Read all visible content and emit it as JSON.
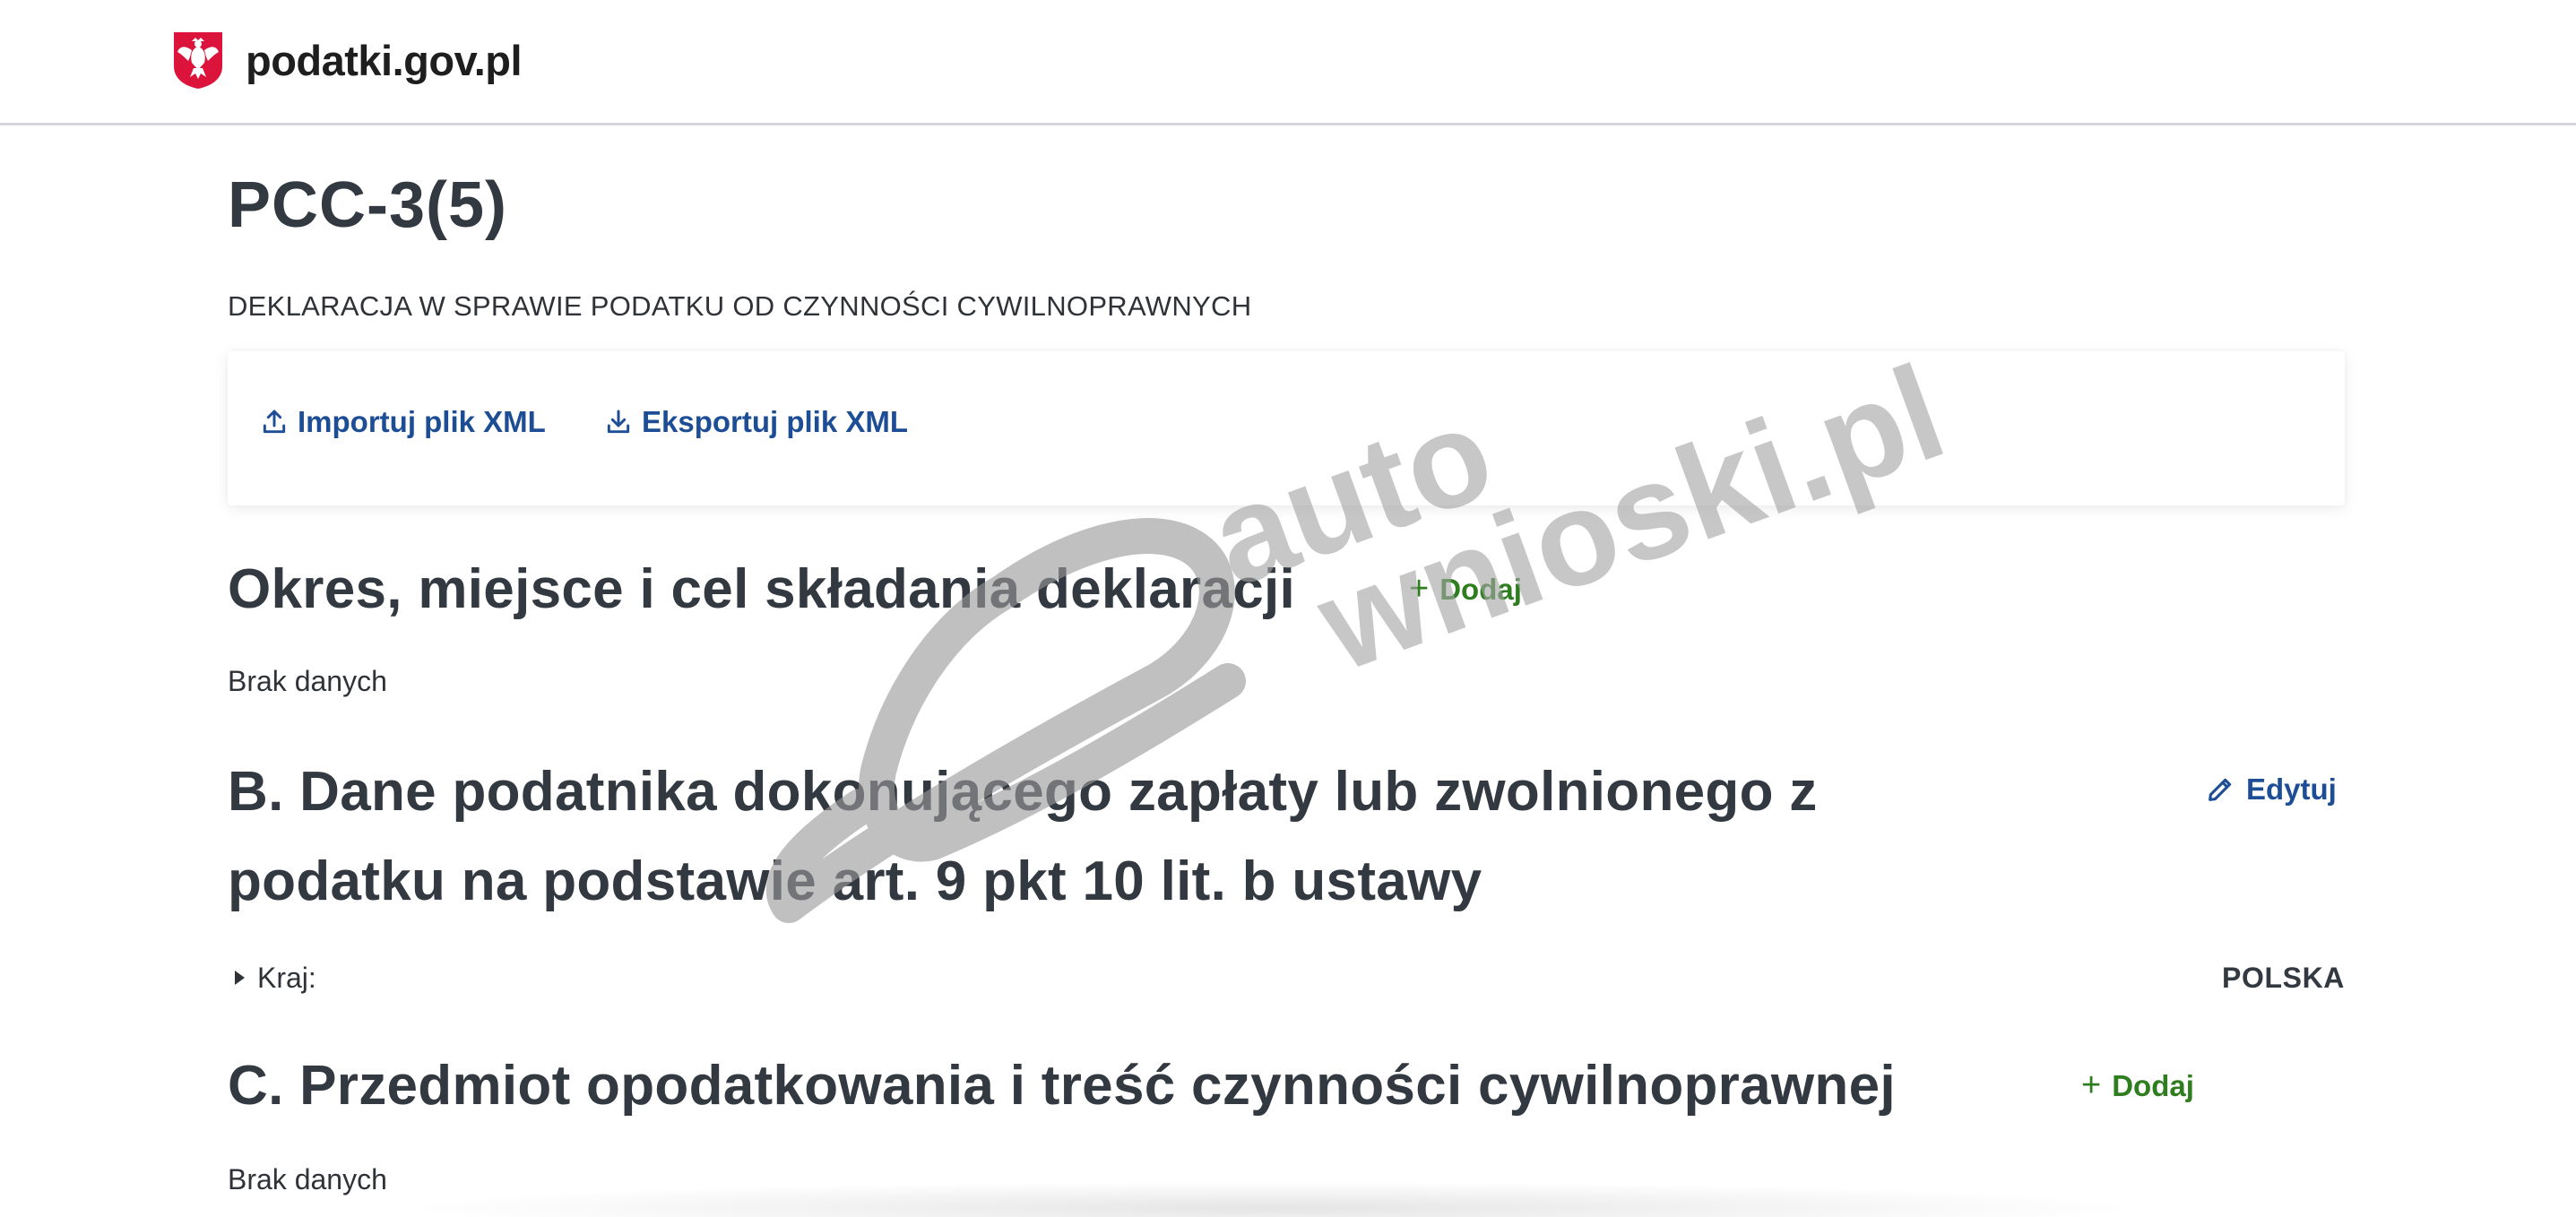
{
  "header": {
    "site_name": "podatki.gov.pl",
    "emblem_icon": "polish-eagle-emblem-icon"
  },
  "form": {
    "code": "PCC-3(5)",
    "subtitle": "DEKLARACJA W SPRAWIE PODATKU OD CZYNNOŚCI CYWILNOPRAWNYCH"
  },
  "toolbar": {
    "import_label": "Importuj plik XML",
    "export_label": "Eksportuj plik XML"
  },
  "sections": [
    {
      "title": "Okres, miejsce i cel składania deklaracji",
      "action_label": "Dodaj",
      "content": "Brak danych"
    },
    {
      "title_line1": "B. Dane podatnika dokonującego zapłaty lub zwolnionego z",
      "title_line2": "podatku na podstawie art. 9 pkt 10 lit. b ustawy",
      "action_label": "Edytuj",
      "field_label": "Kraj:",
      "field_value": "POLSKA"
    },
    {
      "title": "C. Przedmiot opodatkowania i treść czynności cywilnoprawnej",
      "action_label": "Dodaj",
      "content": "Brak danych"
    }
  ],
  "watermark": {
    "line1": "auto",
    "line2": "wnioski.pl"
  },
  "colors": {
    "link_blue": "#1d4e95",
    "add_green": "#2e7d1e",
    "heading": "#333941",
    "emblem_red": "#dc143c"
  }
}
